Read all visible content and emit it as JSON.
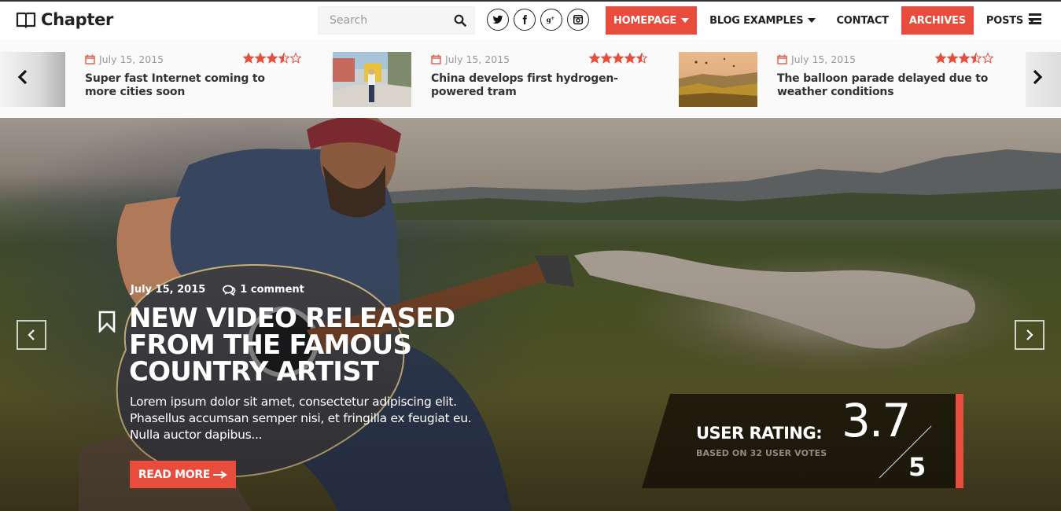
{
  "header": {
    "logo_text": "Chapter",
    "search_placeholder": "Search",
    "social": [
      "twitter",
      "facebook",
      "google-plus",
      "instagram"
    ],
    "nav": [
      {
        "label": "HOMEPAGE",
        "dropdown": true,
        "active": true
      },
      {
        "label": "BLOG EXAMPLES",
        "dropdown": true,
        "active": false
      },
      {
        "label": "CONTACT",
        "dropdown": false,
        "active": false
      },
      {
        "label": "ARCHIVES",
        "dropdown": false,
        "active": true
      },
      {
        "label": "POSTS",
        "dropdown": true,
        "active": false
      }
    ],
    "accent_color": "#e74c3c"
  },
  "ticker": {
    "items": [
      {
        "date": "July 15, 2015",
        "rating": 3.5,
        "title": "Super fast Internet coming to more cities soon"
      },
      {
        "date": "July 15, 2015",
        "rating": 4.5,
        "title": "China develops first hydrogen-powered tram"
      },
      {
        "date": "July 15, 2015",
        "rating": 3.5,
        "title": "The balloon parade delayed due to weather conditions"
      }
    ]
  },
  "hero": {
    "date": "July 15, 2015",
    "comments": "1 comment",
    "title": "NEW VIDEO RELEASED FROM THE FAMOUS COUNTRY ARTIST",
    "excerpt": "Lorem ipsum dolor sit amet, consectetur adipiscing elit. Phasellus accumsan semper nisi, et fringilla ex feugiat eu. Nulla auctor dapibus...",
    "read_more": "READ MORE",
    "rating": {
      "label": "USER RATING:",
      "sub": "BASED ON 32 USER VOTES",
      "value": "3.7",
      "max": "5"
    }
  }
}
